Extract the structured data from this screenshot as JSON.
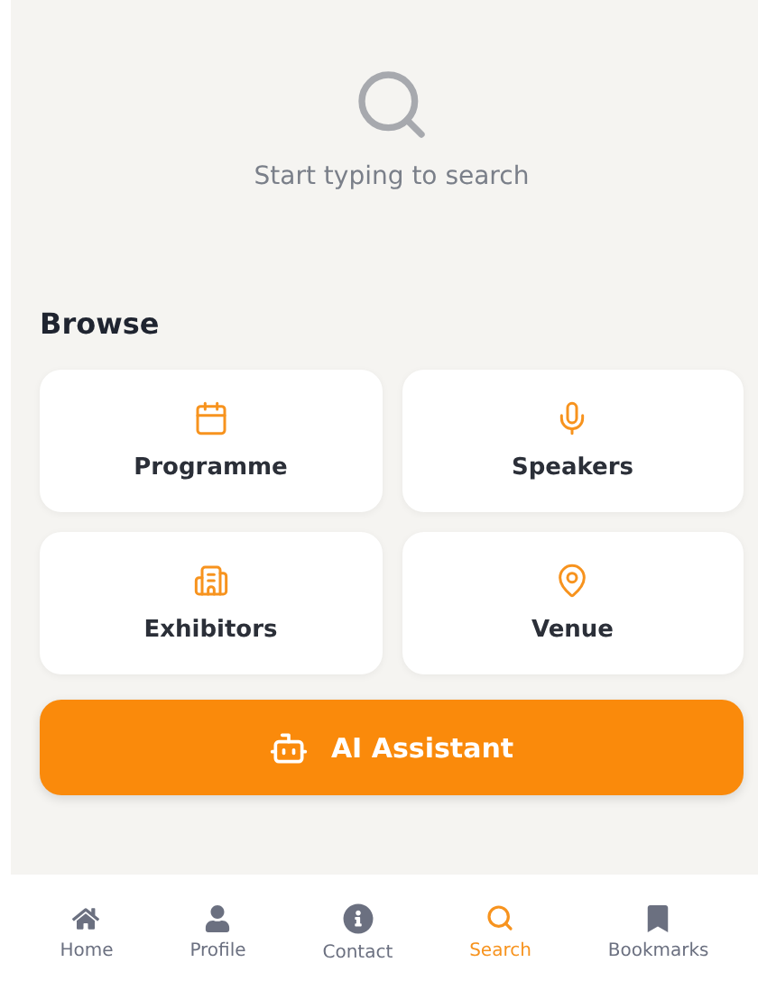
{
  "search": {
    "hint": "Start typing to search"
  },
  "browse": {
    "title": "Browse",
    "items": [
      {
        "label": "Programme",
        "kind": "calendar"
      },
      {
        "label": "Speakers",
        "kind": "mic"
      },
      {
        "label": "Exhibitors",
        "kind": "building"
      },
      {
        "label": "Venue",
        "kind": "pin"
      }
    ]
  },
  "assistant_button": {
    "label": "AI Assistant"
  },
  "nav": [
    {
      "label": "Home",
      "kind": "home",
      "selected": false
    },
    {
      "label": "Profile",
      "kind": "profile",
      "selected": false
    },
    {
      "label": "Contact",
      "kind": "info",
      "selected": false
    },
    {
      "label": "Search",
      "kind": "search",
      "selected": true
    },
    {
      "label": "Bookmarks",
      "kind": "bookmark",
      "selected": false
    }
  ]
}
